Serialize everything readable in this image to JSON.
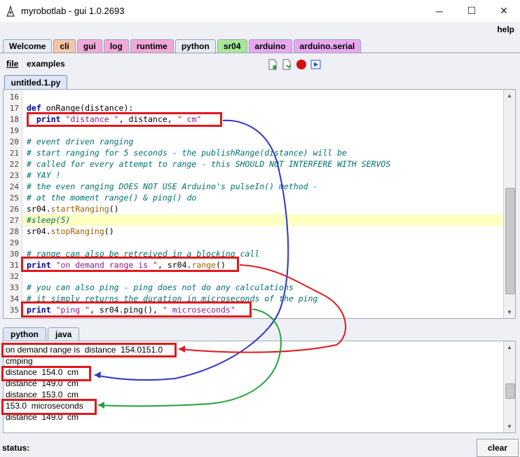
{
  "window": {
    "title": "myrobotlab - gui 1.0.2693",
    "minimize": "─",
    "maximize": "☐",
    "close": "✕"
  },
  "menu": {
    "help": "help",
    "file": "file",
    "examples": "examples"
  },
  "main_tabs": [
    {
      "label": "Welcome",
      "color": "#e8ecf4"
    },
    {
      "label": "cli",
      "color": "#f3c6a8"
    },
    {
      "label": "gui",
      "color": "#f2a8d8"
    },
    {
      "label": "log",
      "color": "#f2a8d8"
    },
    {
      "label": "runtime",
      "color": "#f2a8d8"
    },
    {
      "label": "python",
      "color": "#e6ebf5"
    },
    {
      "label": "sr04",
      "color": "#a8e69a"
    },
    {
      "label": "arduino",
      "color": "#e8a8f0"
    },
    {
      "label": "arduino.serial",
      "color": "#e8a8f0"
    }
  ],
  "toolbar": {
    "icons": [
      "new-file-icon",
      "save-file-icon",
      "record-icon",
      "run-script-icon"
    ]
  },
  "editor": {
    "tab": "untitled.1.py",
    "lines": [
      {
        "n": "16",
        "text": ""
      },
      {
        "n": "17",
        "text": "def onRange(distance):"
      },
      {
        "n": "18",
        "text": "  print \"distance \", distance, \" cm\""
      },
      {
        "n": "19",
        "text": ""
      },
      {
        "n": "20",
        "text": "# event driven ranging"
      },
      {
        "n": "21",
        "text": "# start ranging for 5 seconds - the publishRange(distance) will be"
      },
      {
        "n": "22",
        "text": "# called for every attempt to range - this SHOULD NOT INTERFERE WITH SERVOS"
      },
      {
        "n": "23",
        "text": "# YAY !"
      },
      {
        "n": "24",
        "text": "# the even ranging DOES NOT USE Arduino's pulseIn() method -"
      },
      {
        "n": "25",
        "text": "# at the moment range() & ping() do"
      },
      {
        "n": "26",
        "text": "sr04.startRanging()"
      },
      {
        "n": "27",
        "text": "#sleep(5)"
      },
      {
        "n": "28",
        "text": "sr04.stopRanging()"
      },
      {
        "n": "29",
        "text": ""
      },
      {
        "n": "30",
        "text": "# range can also be retreived in a blocking call"
      },
      {
        "n": "31",
        "text": "print \"on demand range is \", sr04.range()"
      },
      {
        "n": "32",
        "text": ""
      },
      {
        "n": "33",
        "text": "# you can also ping - ping does not do any calculations"
      },
      {
        "n": "34",
        "text": "# it simply returns the duration in microseconds of the ping"
      },
      {
        "n": "35",
        "text": "print \"ping \", sr04.ping(), \" microseconds\""
      }
    ]
  },
  "output_tabs": [
    "python",
    "java"
  ],
  "output_lines": [
    "on demand range is  distance  154.0151.0",
    "cmping",
    "distance  154.0  cm",
    "distance  149.0  cm",
    "distance  153.0  cm",
    "153.0  microseconds",
    "distance  149.0  cm"
  ],
  "status": {
    "label": "status:"
  },
  "clear_button": "clear",
  "annotation_colors": {
    "box": "#e0191f",
    "blue_arrow": "#2b35c8",
    "red_arrow": "#e0191f",
    "green_arrow": "#23a33a"
  }
}
